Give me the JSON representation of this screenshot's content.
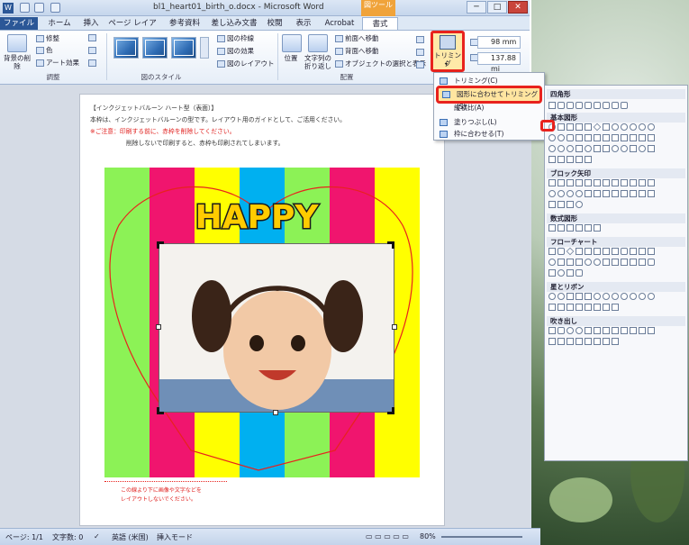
{
  "window": {
    "title": "bl1_heart01_birth_o.docx - Microsoft Word",
    "context_tab": "図ツール",
    "minimize": "─",
    "maximize": "□",
    "close": "✕"
  },
  "tabs": {
    "file": "ファイル",
    "home": "ホーム",
    "insert": "挿入",
    "layout": "ページ レイアウト",
    "references": "参考資料",
    "mailings": "差し込み文書",
    "review": "校閲",
    "view": "表示",
    "acrobat": "Acrobat",
    "format": "書式"
  },
  "ribbon": {
    "remove_bg": "背景の削除",
    "correction": "修整",
    "color": "色",
    "artistic": "アート効果",
    "adjust_group": "調整",
    "style_group": "図のスタイル",
    "border": "図の枠線",
    "effects": "図の効果",
    "layout": "図のレイアウト",
    "position": "位置",
    "wrap": "文字列の折り返し",
    "bring_forward": "前面へ移動",
    "send_backward": "背面へ移動",
    "selection_pane": "オブジェクトの選択と表示",
    "arrange_group": "配置",
    "crop": "トリミング",
    "height": "98 mm",
    "width": "137.88 mi"
  },
  "crop_menu": {
    "crop": "トリミング(C)",
    "crop_to_shape": "図形に合わせてトリミング(S)",
    "aspect_ratio": "縦横比(A)",
    "fill": "塗りつぶし(L)",
    "fit": "枠に合わせる(T)"
  },
  "shapes_panel": {
    "rect": "四角形",
    "basic": "基本図形",
    "block_arrows": "ブロック矢印",
    "equation": "数式図形",
    "flowchart": "フローチャート",
    "stars": "星とリボン",
    "callouts": "吹き出し"
  },
  "document": {
    "line1": "【インクジェットバルーン ハート型（表面）】",
    "line2": "本枠は、インクジェットバルーンの型です。レイアウト用のガイドとして、ご活用ください。",
    "line3": "※ご注意：印刷する前に、赤枠を削除してください。",
    "line4": "削除しないで印刷すると、赤枠も印刷されてしまいます。",
    "happy": "HAPPY",
    "footer1": "この線より下に画像や文字などを",
    "footer2": "レイアウトしないでください。",
    "stripe_colors": [
      "#8cf256",
      "#f0156e",
      "#ffff00",
      "#00b0f0",
      "#8cf256",
      "#f0156e",
      "#ffff00"
    ]
  },
  "status": {
    "page": "ページ: 1/1",
    "words": "文字数: 0",
    "language": "英語 (米国)",
    "mode": "挿入モード",
    "zoom": "80%"
  }
}
